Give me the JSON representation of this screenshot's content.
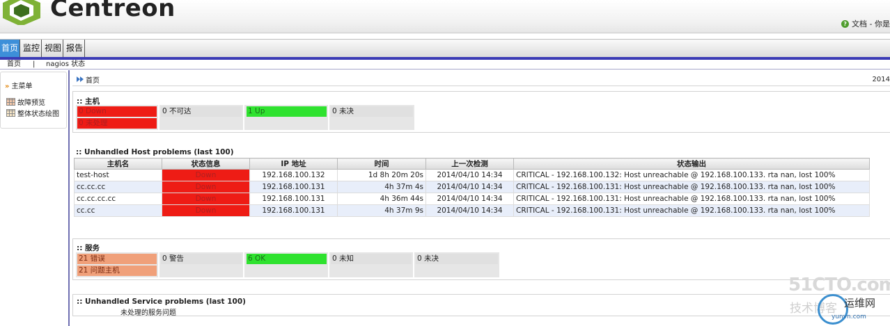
{
  "header": {
    "brand": "Centreon",
    "doc_link": "文档 - 你是",
    "help_icon": "help-icon",
    "logo_icon": "centreon-cube-icon"
  },
  "nav": {
    "tabs": [
      "首页",
      "监控",
      "视图",
      "报告"
    ],
    "active": "首页"
  },
  "subnav": {
    "items": [
      "首页",
      "|",
      "nagios 状态"
    ]
  },
  "left": {
    "menu_title": "主菜单",
    "links": [
      {
        "label": "故障预览",
        "icon": "grid-chart-icon"
      },
      {
        "label": "整体状态绘图",
        "icon": "grid-table-icon"
      }
    ]
  },
  "breadcrumb": {
    "label": "首页",
    "date": "2014"
  },
  "hosts": {
    "title": ":: 主机",
    "down": "0 Down",
    "unhandled": "0 未处理",
    "unreachable": "0 不可达",
    "up": "1 Up",
    "pending": "0 未决"
  },
  "host_problems": {
    "title": ":: Unhandled Host problems (last 100)",
    "columns": [
      "主机名",
      "状态信息",
      "IP 地址",
      "时间",
      "上一次检测",
      "状态输出"
    ],
    "rows": [
      {
        "host": "test-host",
        "status": "Down",
        "ip": "192.168.100.132",
        "duration": "1d 8h 20m 20s",
        "last_check": "2014/04/10 14:34",
        "output": "CRITICAL - 192.168.100.132: Host unreachable @ 192.168.100.133. rta nan, lost 100%"
      },
      {
        "host": "cc.cc.cc",
        "status": "Down",
        "ip": "192.168.100.131",
        "duration": "4h 37m 4s",
        "last_check": "2014/04/10 14:34",
        "output": "CRITICAL - 192.168.100.131: Host unreachable @ 192.168.100.133. rta nan, lost 100%"
      },
      {
        "host": "cc.cc.cc.cc",
        "status": "Down",
        "ip": "192.168.100.131",
        "duration": "4h 36m 44s",
        "last_check": "2014/04/10 14:34",
        "output": "CRITICAL - 192.168.100.131: Host unreachable @ 192.168.100.133. rta nan, lost 100%"
      },
      {
        "host": "cc.cc",
        "status": "Down",
        "ip": "192.168.100.131",
        "duration": "4h 37m 9s",
        "last_check": "2014/04/10 14:34",
        "output": "CRITICAL - 192.168.100.131: Host unreachable @ 192.168.100.133. rta nan, lost 100%"
      }
    ]
  },
  "services": {
    "title": ":: 服务",
    "critical": "21 错误",
    "problem_hosts": "21 问题主机",
    "warning": "0 警告",
    "ok": "6 OK",
    "unknown": "0 未知",
    "pending": "0 未决"
  },
  "service_problems": {
    "title": ":: Unhandled Service problems (last 100)",
    "subtitle": "未处理的服务问题"
  },
  "watermark": {
    "site": "51CTO.com",
    "blog": "技术博客",
    "cn": "运维网",
    "url": "yunvn.com"
  },
  "colors": {
    "down": "#ee1c15",
    "up": "#2fe22f",
    "critical": "#f0a07a",
    "active_tab": "#3d8fd9",
    "nav_strip": "#3b3bb5"
  }
}
